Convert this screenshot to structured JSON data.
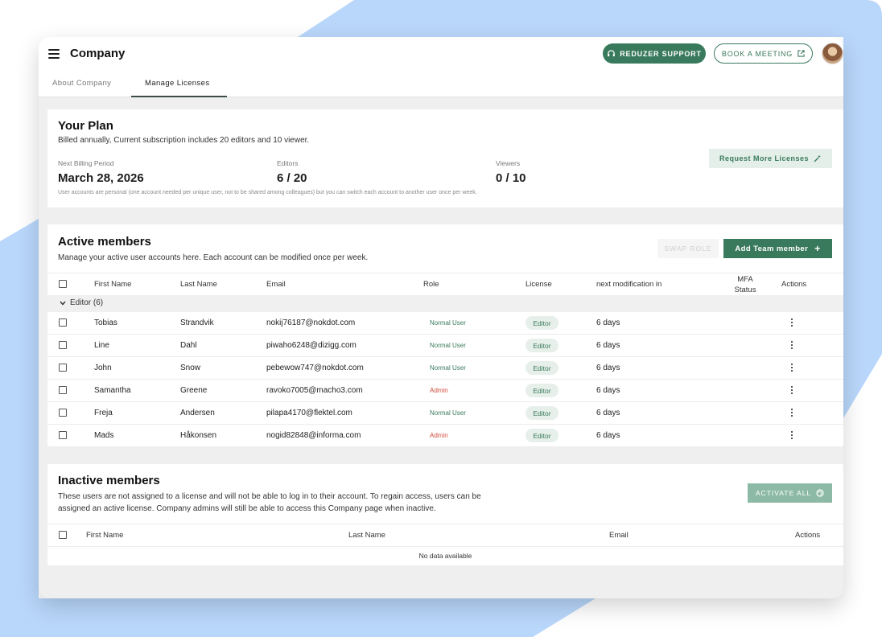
{
  "header": {
    "title": "Company",
    "support_label": "REDUZER SUPPORT",
    "meeting_label": "BOOK A MEETING"
  },
  "tabs": [
    {
      "label": "About Company",
      "active": false
    },
    {
      "label": "Manage Licenses",
      "active": true
    }
  ],
  "plan": {
    "title": "Your Plan",
    "subtitle": "Billed annually, Current subscription includes 20 editors and 10 viewer.",
    "billing_label": "Next Billing Period",
    "billing_value": "March 28, 2026",
    "editors_label": "Editors",
    "editors_value": "6 / 20",
    "viewers_label": "Viewers",
    "viewers_value": "0 / 10",
    "note": "User accounts are personal (one account needed per unique user, not to be shared among colleagues) but you can switch each account to another user once per week.",
    "request_label": "Request More Licenses"
  },
  "active": {
    "title": "Active members",
    "subtitle": "Manage your active user accounts here. Each account can be modified once per week.",
    "swap_label": "SWAP ROLE",
    "add_label": "Add Team member",
    "columns": {
      "first": "First Name",
      "last": "Last Name",
      "email": "Email",
      "role": "Role",
      "license": "License",
      "next": "next modification in",
      "mfa": "MFA Status",
      "actions": "Actions"
    },
    "group_label": "Editor (6)",
    "rows": [
      {
        "first": "Tobias",
        "last": "Strandvik",
        "email": "nokij76187@nokdot.com",
        "role": "Normal User",
        "license": "Editor",
        "next": "6 days"
      },
      {
        "first": "Line",
        "last": "Dahl",
        "email": "piwaho6248@dizigg.com",
        "role": "Normal User",
        "license": "Editor",
        "next": "6 days"
      },
      {
        "first": "John",
        "last": "Snow",
        "email": "pebewow747@nokdot.com",
        "role": "Normal User",
        "license": "Editor",
        "next": "6 days"
      },
      {
        "first": "Samantha",
        "last": "Greene",
        "email": "ravoko7005@macho3.com",
        "role": "Admin",
        "license": "Editor",
        "next": "6 days"
      },
      {
        "first": "Freja",
        "last": "Andersen",
        "email": "pilapa4170@flektel.com",
        "role": "Normal User",
        "license": "Editor",
        "next": "6 days"
      },
      {
        "first": "Mads",
        "last": "Håkonsen",
        "email": "nogid82848@informa.com",
        "role": "Admin",
        "license": "Editor",
        "next": "6 days"
      }
    ]
  },
  "inactive": {
    "title": "Inactive members",
    "subtitle_line1": "These users are not assigned to a license and will not be able to log in to their account. To regain access, users can be",
    "subtitle_line2": "assigned an active license. Company admins will still be able to access this Company page when inactive.",
    "activate_label": "ACTIVATE ALL",
    "columns": {
      "first": "First Name",
      "last": "Last Name",
      "email": "Email",
      "actions": "Actions"
    },
    "empty_text": "No data available"
  },
  "colors": {
    "accent": "#3a7a5c",
    "admin": "#d24b3e",
    "background_shape": "#b9d7fb"
  }
}
